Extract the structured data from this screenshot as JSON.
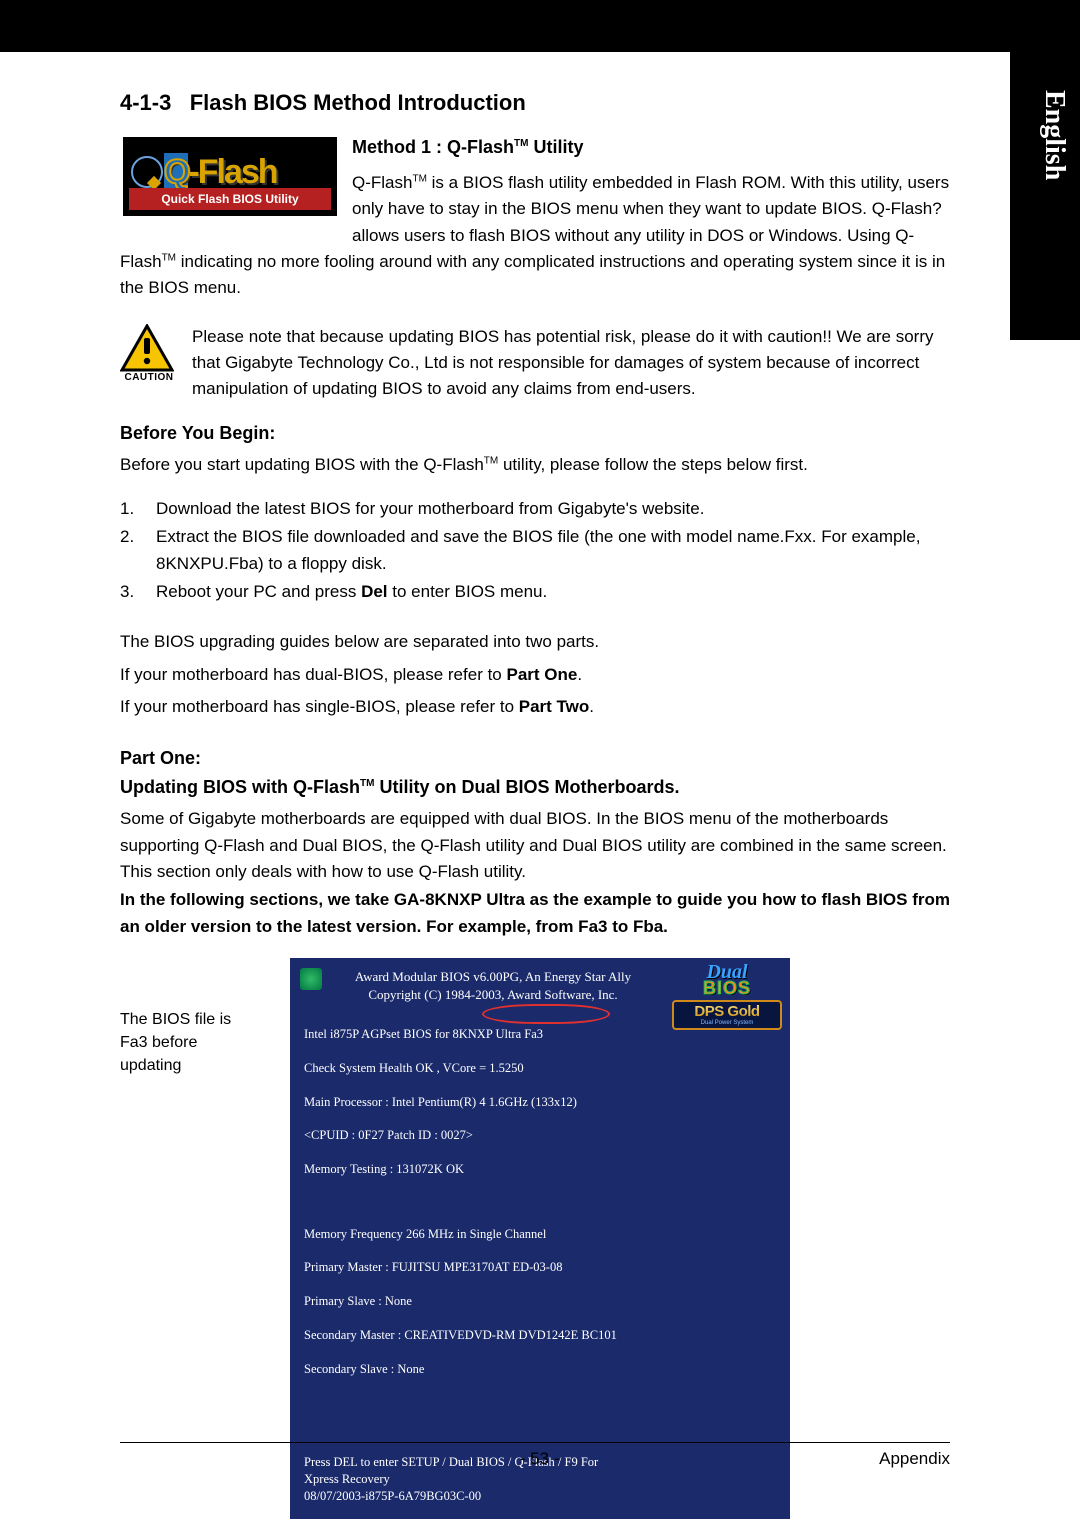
{
  "lang_tab": "English",
  "section_number": "4-1-3",
  "section_title": "Flash BIOS Method Introduction",
  "qflash_logo": {
    "main": "-Flash",
    "q": "Q",
    "band": "Quick Flash BIOS Utility"
  },
  "method1_heading_pre": "Method 1 : Q-Flash",
  "method1_heading_post": " Utility",
  "method1_p1_a": "Q-Flash",
  "method1_p1_b": " is a BIOS flash utility embedded in Flash ROM. With this utility, users only have to stay in the BIOS menu when they want to update BIOS. Q-Flash?allows users to flash BIOS without any utility in DOS or Windows. Using Q-Flash",
  "method1_p1_c": " indicating no more fooling around with any complicated instructions and operating system since it is in the BIOS menu.",
  "caution_label": "CAUTION",
  "caution_text": "Please note that because updating BIOS has potential risk, please do it with caution!! We are sorry that Gigabyte Technology Co., Ltd is not responsible for damages of system because of incorrect manipulation of updating BIOS to avoid any claims from end-users.",
  "before_heading": "Before You Begin:",
  "before_intro_a": "Before you start updating BIOS with the Q-Flash",
  "before_intro_b": " utility, please follow the steps below first.",
  "steps": [
    "Download the latest BIOS for your motherboard from Gigabyte's website.",
    "Extract the BIOS file downloaded and save the BIOS file (the one with model name.Fxx. For example, 8KNXPU.Fba) to a floppy disk.",
    "Reboot your PC and press Del to enter BIOS menu."
  ],
  "step3_pre": "Reboot your PC and press ",
  "step3_bold": "Del",
  "step3_post": " to enter BIOS menu.",
  "guides_line1": "The BIOS upgrading guides below are separated into two parts.",
  "guides_line2_pre": "If your motherboard has dual-BIOS, please refer to ",
  "guides_line2_bold": "Part One",
  "guides_line2_post": ".",
  "guides_line3_pre": "If your motherboard has single-BIOS, please refer to ",
  "guides_line3_bold": "Part Two",
  "guides_line3_post": ".",
  "partone_label": "Part One:",
  "partone_heading_pre": "Updating BIOS with Q-Flash",
  "partone_heading_post": " Utility on Dual BIOS Motherboards.",
  "partone_p1": "Some of Gigabyte motherboards are equipped with dual BIOS. In the BIOS menu of the motherboards supporting Q-Flash and Dual BIOS, the Q-Flash utility and Dual BIOS utility are combined in the same screen. This section only deals with how to use Q-Flash utility.",
  "partone_bold": "In the following sections, we take GA-8KNXP Ultra as the example to guide you how to flash BIOS from an older version to the latest version. For example, from Fa3 to Fba.",
  "caption": "The BIOS file is Fa3 before updating",
  "bios": {
    "header1": "Award Modular BIOS v6.00PG, An Energy Star Ally",
    "header2": "Copyright  (C) 1984-2003, Award Software,  Inc.",
    "l1": "Intel i875P AGPset BIOS for 8KNXP Ultra Fa3",
    "l2": "Check System Health OK , VCore = 1.5250",
    "l3": "Main Processor : Intel Pentium(R) 4  1.6GHz (133x12)",
    "l4": "<CPUID : 0F27 Patch ID  : 0027>",
    "l5": "Memory Testing  : 131072K OK",
    "b1": "Memory Frequency 266 MHz in Single Channel",
    "b2": "Primary Master : FUJITSU MPE3170AT ED-03-08",
    "b3": "Primary Slave : None",
    "b4": "Secondary Master :  CREATIVEDVD-RM DVD1242E BC101",
    "b5": "Secondary Slave : None",
    "f1": "Press DEL to enter SETUP / Dual BIOS / Q-Flash / F9 For",
    "f2": "Xpress Recovery",
    "f3": "08/07/2003-i875P-6A79BG03C-00",
    "dual_top": "Dual",
    "dual_bot": "BIOS",
    "dps_top": "DPS",
    "dps_gold": "Gold",
    "dps_sub": "Dual Power System"
  },
  "tm": "TM",
  "footer": {
    "page": "- 53 -",
    "section": "Appendix"
  }
}
